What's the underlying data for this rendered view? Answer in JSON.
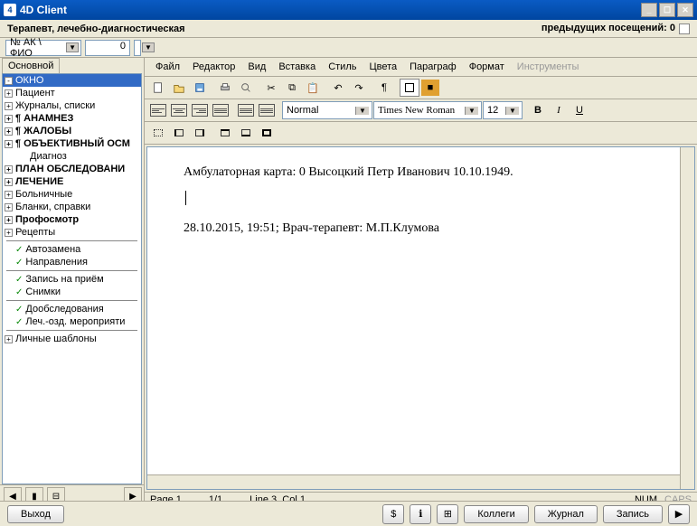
{
  "window": {
    "title": "4D Client"
  },
  "subtitle": {
    "left": "Терапевт, лечебно-диагностическая",
    "right": "предыдущих посещений: 0"
  },
  "topbar": {
    "selector": "№ АК \\ ФИО",
    "value": "0"
  },
  "sidebar": {
    "tab": "Основной",
    "items": [
      {
        "label": "ОКНО",
        "box": "-",
        "bold": false,
        "selected": true
      },
      {
        "label": "Пациент",
        "box": "+",
        "bold": false
      },
      {
        "label": "Журналы, списки",
        "box": "+",
        "bold": false
      },
      {
        "label": "¶ АНАМНЕЗ",
        "box": "+",
        "bold": true
      },
      {
        "label": "¶ ЖАЛОБЫ",
        "box": "+",
        "bold": true
      },
      {
        "label": "¶ ОБЪЕКТИВНЫЙ ОСМ",
        "box": "+",
        "bold": true
      },
      {
        "label": "Диагноз",
        "box": "",
        "bold": false,
        "indent": true
      },
      {
        "label": "ПЛАН ОБСЛЕДОВАНИ",
        "box": "+",
        "bold": true
      },
      {
        "label": "ЛЕЧЕНИЕ",
        "box": "+",
        "bold": true
      },
      {
        "label": "Больничные",
        "box": "+",
        "bold": false
      },
      {
        "label": "Бланки, справки",
        "box": "+",
        "bold": false
      },
      {
        "label": "Профосмотр",
        "box": "+",
        "bold": true
      },
      {
        "label": "Рецепты",
        "box": "+",
        "bold": false
      }
    ],
    "extra1": [
      {
        "label": "Автозамена"
      },
      {
        "label": "Направления"
      }
    ],
    "extra2": [
      {
        "label": "Запись на приём"
      },
      {
        "label": "Снимки"
      }
    ],
    "extra3": [
      {
        "label": "Дообследования"
      },
      {
        "label": "Леч.-озд. мероприяти"
      }
    ],
    "extra4": [
      {
        "label": "Личные шаблоны",
        "box": "+"
      }
    ]
  },
  "menubar": [
    "Файл",
    "Редактор",
    "Вид",
    "Вставка",
    "Стиль",
    "Цвета",
    "Параграф",
    "Формат",
    "Инструменты"
  ],
  "format": {
    "style_name": "Normal",
    "font_name": "Times New Roman",
    "font_size": "12",
    "bold": "B",
    "italic": "I",
    "underline": "U"
  },
  "document": {
    "line1": "Амбулаторная карта:   0 Высоцкий Петр Иванович 10.10.1949.",
    "line2": "28.10.2015, 19:51;  Врач-терапевт: М.П.Клумова"
  },
  "status": {
    "page": "Page 1",
    "pages": "1/1",
    "pos": "Line 3, Col 1",
    "num": "NUM",
    "caps": "CAPS"
  },
  "bottom": {
    "exit": "Выход",
    "colleagues": "Коллеги",
    "journal": "Журнал",
    "record": "Запись"
  }
}
